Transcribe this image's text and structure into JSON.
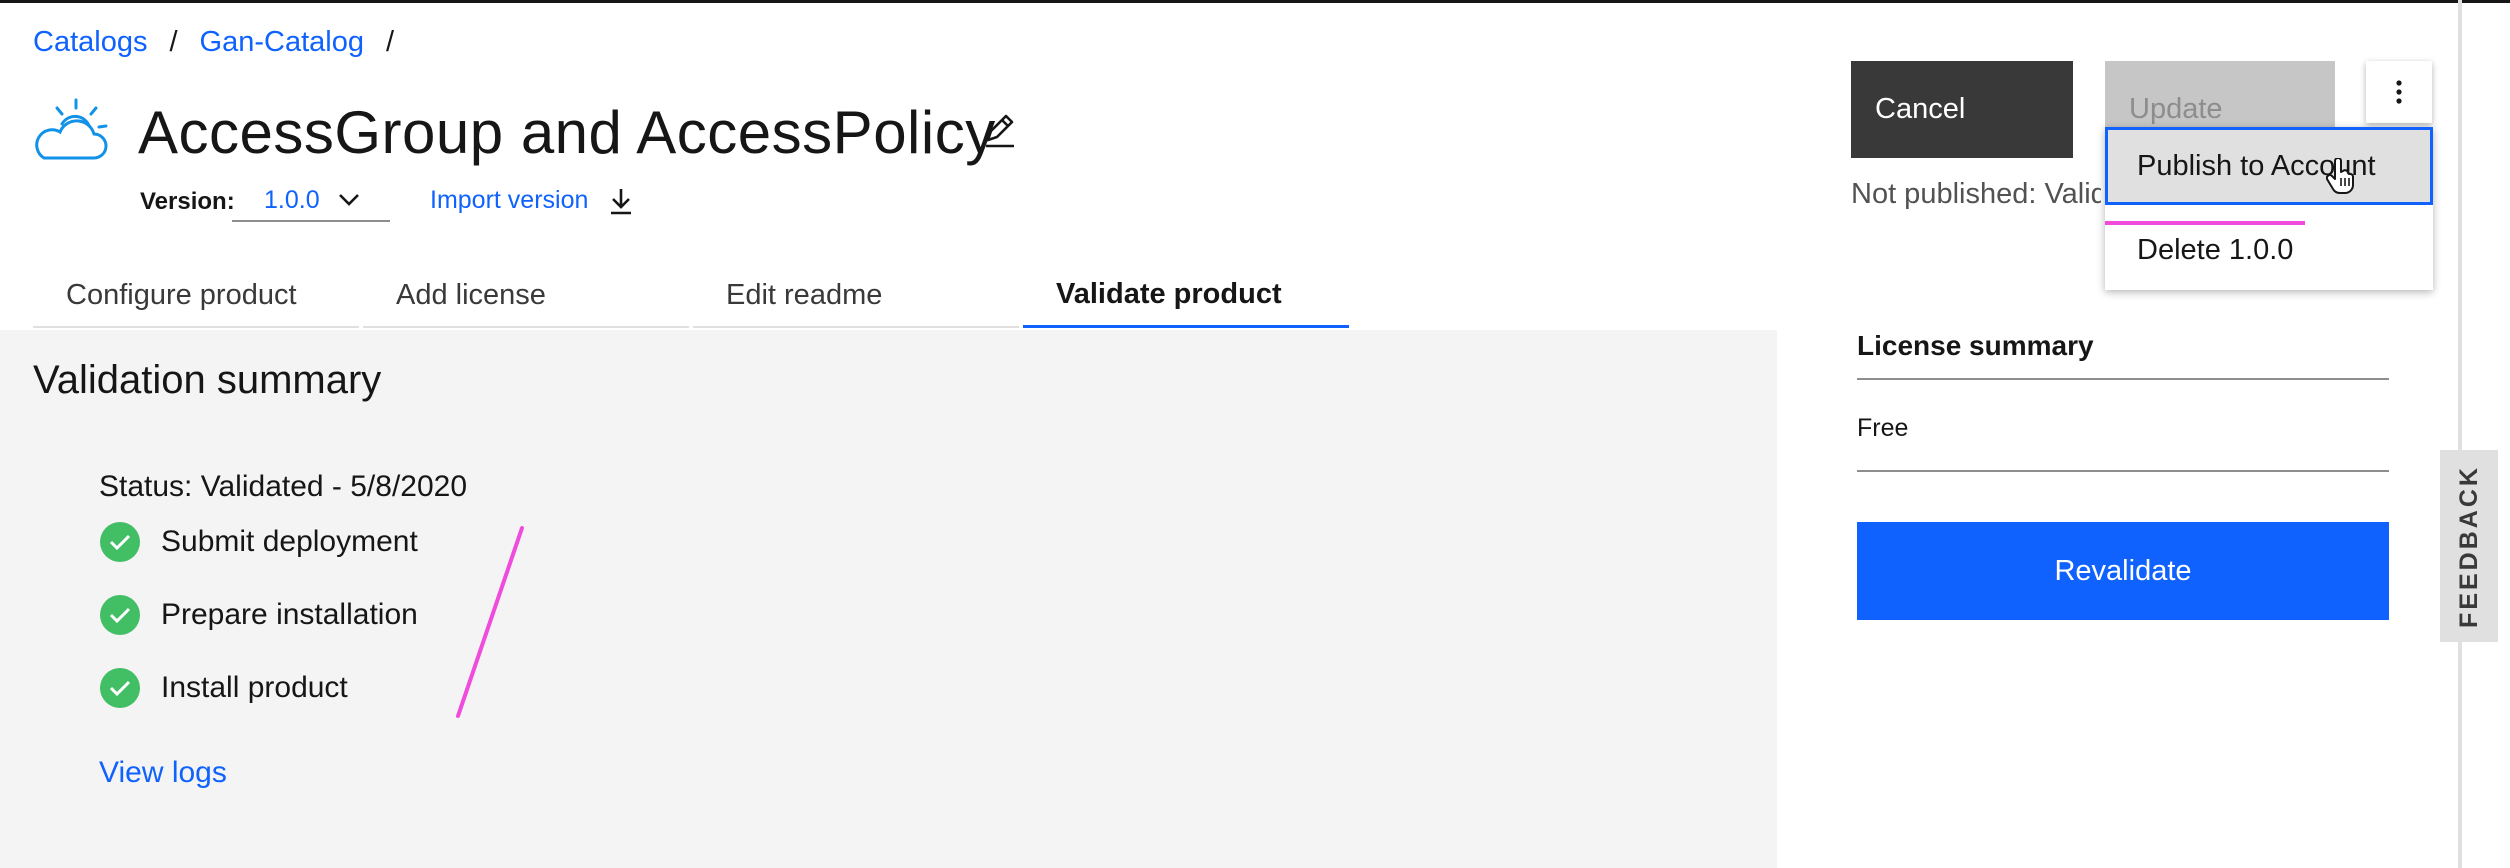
{
  "breadcrumb": {
    "items": [
      "Catalogs",
      "Gan-Catalog"
    ],
    "separator": "/"
  },
  "header": {
    "title": "AccessGroup and AccessPolicy",
    "version_label": "Version:",
    "version_value": "1.0.0",
    "import_version": "Import version"
  },
  "tabs": [
    {
      "label": "Configure product",
      "active": false
    },
    {
      "label": "Add license",
      "active": false
    },
    {
      "label": "Edit readme",
      "active": false
    },
    {
      "label": "Validate product",
      "active": true
    }
  ],
  "actions": {
    "cancel": "Cancel",
    "update": "Update",
    "not_published": "Not published: Valid"
  },
  "overflow_menu": {
    "items": [
      "Publish to Account",
      "Delete 1.0.0"
    ],
    "hovered_index": 0
  },
  "validation": {
    "title": "Validation summary",
    "status": "Status: Validated - 5/8/2020",
    "steps": [
      "Submit deployment",
      "Prepare installation",
      "Install product"
    ],
    "view_logs": "View logs"
  },
  "license": {
    "title": "License summary",
    "value": "Free"
  },
  "revalidate": "Revalidate",
  "feedback": "FEEDBACK",
  "colors": {
    "primary": "#0f62fe",
    "success": "#42be65",
    "dark_button": "#393939",
    "disabled_button": "#c6c6c6",
    "panel_bg": "#f4f4f4",
    "annotation": "#f04bdc"
  }
}
